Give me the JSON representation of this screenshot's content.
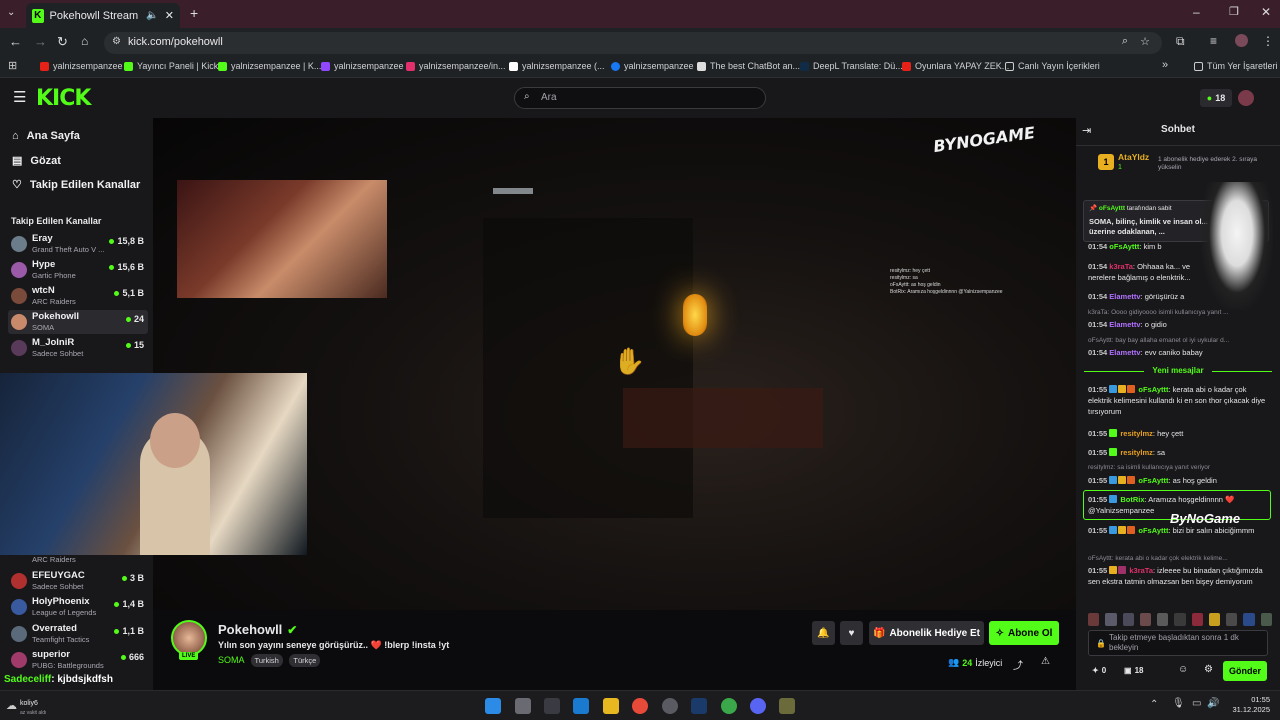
{
  "browser": {
    "tab_title": "Pokehowll Stream - Watch L",
    "url": "kick.com/pokehowll",
    "bookmarks": [
      {
        "label": "yalnizsempanzee",
        "color": "#e62117"
      },
      {
        "label": "Yayıncı Paneli | Kick",
        "color": "#53fc18"
      },
      {
        "label": "yalnizsempanzee | K...",
        "color": "#53fc18"
      },
      {
        "label": "yalnizsempanzee",
        "color": "#9146ff"
      },
      {
        "label": "yalnizsempanzee/in...",
        "color": "#e1306c"
      },
      {
        "label": "yalnizsempanzee (...",
        "color": "#ffffff"
      },
      {
        "label": "yalnizsempanzee",
        "color": "#1877f2"
      },
      {
        "label": "The best ChatBot an...",
        "color": "#dddddd"
      },
      {
        "label": "DeepL Translate: Dü...",
        "color": "#0f2b46"
      },
      {
        "label": "Oyunlara YAPAY ZEK...",
        "color": "#e62117"
      },
      {
        "label": "Canlı Yayın İçerikleri",
        "color": "#cccccc"
      }
    ],
    "all_bookmarks": "Tüm Yer İşaretleri"
  },
  "header": {
    "logo": "KICK",
    "search_placeholder": "Ara",
    "points": "18"
  },
  "sidebar": {
    "nav": [
      {
        "label": "Ana Sayfa",
        "icon": "home-icon"
      },
      {
        "label": "Gözat",
        "icon": "browse-icon"
      },
      {
        "label": "Takip Edilen Kanallar",
        "icon": "heart-icon"
      }
    ],
    "section_title": "Takip Edilen Kanallar",
    "channels_top": [
      {
        "name": "Eray",
        "category": "Grand Theft Auto V ...",
        "viewers": "15,8 B",
        "color": "#6b7c8a"
      },
      {
        "name": "Hype",
        "category": "Gartic Phone",
        "viewers": "15,6 B",
        "color": "#9a5aa8"
      },
      {
        "name": "wtcN",
        "category": "ARC Raiders",
        "viewers": "5,1 B",
        "color": "#7a4a3a"
      },
      {
        "name": "Pokehowll",
        "category": "SOMA",
        "viewers": "24",
        "color": "#c88a6a"
      },
      {
        "name": "M_JolniR",
        "category": "Sadece Sohbet",
        "viewers": "15",
        "color": "#5a3a5a"
      }
    ],
    "hidden_category": "ARC Raiders",
    "channels_bottom": [
      {
        "name": "EFEUYGAC",
        "category": "Sadece Sohbet",
        "viewers": "3 B",
        "color": "#b03030"
      },
      {
        "name": "HolyPhoenix",
        "category": "League of Legends",
        "viewers": "1,4 B",
        "color": "#3a5aa0"
      },
      {
        "name": "Overrated",
        "category": "Teamfight Tactics",
        "viewers": "1,1 B",
        "color": "#5a6a7a"
      },
      {
        "name": "superior",
        "category": "PUBG: Battlegrounds",
        "viewers": "666",
        "color": "#a03a6a"
      }
    ]
  },
  "video": {
    "overlay_logo": "BYNOGAME",
    "overlay_chat": [
      "resitylmz: hey çett",
      "resitylmz: sa",
      "oFsAyttt: as hoş geldin",
      "BotRix: Aramıza hoşgeldinnnn @Yalnizsempanzee"
    ],
    "ticker_user": "Sadeceliff",
    "ticker_text": ": kjbdsjkdfsh"
  },
  "stream": {
    "streamer": "Pokehowll",
    "live": "LIVE",
    "title": "Yılın son yayını seneye görüşürüz.. ❤️ !blerp !insta !yt",
    "category": "SOMA",
    "tags": [
      "Turkish",
      "Türkçe"
    ],
    "gift_label": "Abonelik Hediye Et",
    "subscribe_label": "Abone Ol",
    "viewers": "24",
    "viewers_label": "İzleyici"
  },
  "chat": {
    "title": "Sohbet",
    "top_gifter": "AtaYldz",
    "top_gifter_count": "1",
    "gifter_note": "1 abonelik hediye ederek 2. sıraya yükselin",
    "pinned_by": "oFsAyttt",
    "pinned_suffix": "tarafından sabit",
    "pinned_text": "SOMA, bilinç, kimlik ve insan ol... anlamı üzerine odaklanan, ...",
    "messages_old": [
      {
        "time": "01:54",
        "user": "oFsAyttt",
        "text": ": kim b",
        "color": "#53fc18"
      },
      {
        "time": "01:54",
        "user": "k3raTa",
        "text": ": Ohhaaa ka... ve nerelere bağlamış o elenktrik...",
        "color": "#e0306a"
      },
      {
        "time": "01:54",
        "user": "Elamettv",
        "text": ": görüşürüz a",
        "color": "#b070ff"
      }
    ],
    "reply_1": "k3raTa: Oooo gidiyoooo isimli kullanıcıya yanıt ...",
    "msg_gidio": {
      "time": "01:54",
      "user": "Elamettv",
      "text": ": o gidio",
      "color": "#b070ff"
    },
    "reply_2": "oFsAyttt: bay bay allaha emanet ol iyi uykular d...",
    "msg_evv": {
      "time": "01:54",
      "user": "Elamettv",
      "text": ": evv caniko babay",
      "color": "#b070ff"
    },
    "new_messages": "Yeni mesajlar",
    "messages_new": [
      {
        "time": "01:55",
        "user": "oFsAyttt",
        "text": ": kerata abi o kadar çok elektrik kelimesini kullandı ki en son thor çıkacak diye tırsıyorum",
        "color": "#53fc18"
      },
      {
        "time": "01:55",
        "user": "resitylmz",
        "text": ": hey çett",
        "color": "#e8a020"
      },
      {
        "time": "01:55",
        "user": "resitylmz",
        "text": ": sa",
        "color": "#e8a020"
      }
    ],
    "reply_3": "resitylmz: sa isimli kullanıcıya yanıt veriyor",
    "msg_as": {
      "time": "01:55",
      "user": "oFsAyttt",
      "text": ": as hoş geldin",
      "color": "#53fc18"
    },
    "msg_bot": {
      "time": "01:55",
      "user": "BotRix",
      "text": ": Aramıza hoşgeldinnnn ❤️ @Yalnizsempanzee",
      "color": "#53fc18"
    },
    "msg_salin": {
      "time": "01:55",
      "user": "oFsAyttt",
      "text": ": bizi bir salın abiciğimmm",
      "color": "#53fc18"
    },
    "reply_4": "oFsAyttt: kerata abi o kadar çok elektrik kelime...",
    "msg_k3": {
      "time": "01:55",
      "user": "k3raTa",
      "text": ": izleeee bu binadan çıktığımızda sen ekstra tatmin olmazsan ben bişey demiyorum",
      "color": "#e0306a"
    },
    "input_placeholder": "Takip etmeye başladıktan sonra 1 dk bekleyin",
    "stat_1": "0",
    "stat_2": "18",
    "send_label": "Gönder",
    "watermark": "ByNoGame"
  },
  "taskbar": {
    "user": "koliy6",
    "user_status": "az vakit aldı",
    "time": "01:55",
    "date": "31.12.2025"
  }
}
